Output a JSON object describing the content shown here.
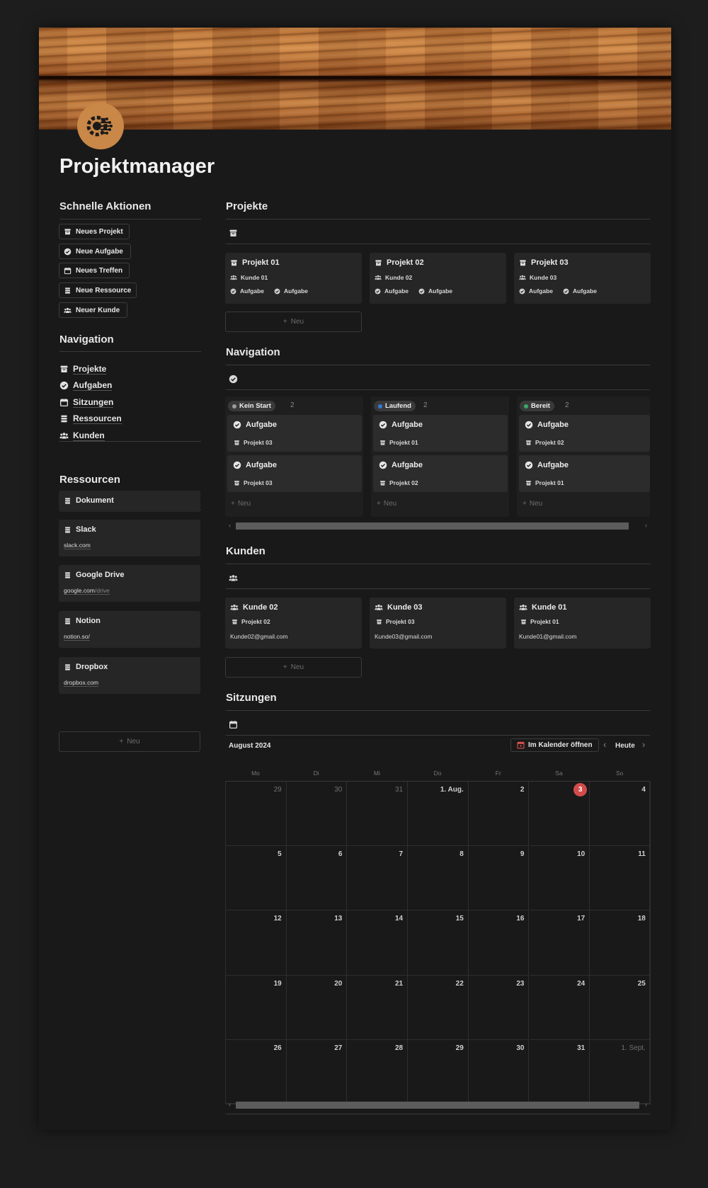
{
  "page_title": "Projektmanager",
  "quick": {
    "heading": "Schnelle Aktionen",
    "buttons": [
      {
        "label": "Neues Projekt",
        "icon": "archive-icon"
      },
      {
        "label": "Neue Aufgabe",
        "icon": "check-circle-icon"
      },
      {
        "label": "Neues Treffen",
        "icon": "calendar-icon"
      },
      {
        "label": "Neue Ressource",
        "icon": "stack-icon"
      },
      {
        "label": "Neuer Kunde",
        "icon": "people-icon"
      }
    ]
  },
  "nav": {
    "heading": "Navigation",
    "items": [
      {
        "label": "Projekte",
        "icon": "archive-icon"
      },
      {
        "label": "Aufgaben",
        "icon": "check-circle-icon"
      },
      {
        "label": "Sitzungen",
        "icon": "calendar-icon"
      },
      {
        "label": "Ressourcen",
        "icon": "stack-icon"
      },
      {
        "label": "Kunden",
        "icon": "people-icon"
      }
    ]
  },
  "resources": {
    "heading": "Ressourcen",
    "new_label": "Neu",
    "items": [
      {
        "name": "Dokument",
        "url": "",
        "url_muted": ""
      },
      {
        "name": "Slack",
        "url": "slack.com",
        "url_muted": ""
      },
      {
        "name": "Google Drive",
        "url": "google.com",
        "url_muted": "/drive"
      },
      {
        "name": "Notion",
        "url": "notion.so/",
        "url_muted": ""
      },
      {
        "name": "Dropbox",
        "url": "dropbox.com",
        "url_muted": ""
      }
    ]
  },
  "projects": {
    "heading": "Projekte",
    "new_label": "Neu",
    "items": [
      {
        "name": "Projekt 01",
        "client": "Kunde 01",
        "task1": "Aufgabe",
        "task2": "Aufgabe"
      },
      {
        "name": "Projekt 02",
        "client": "Kunde 02",
        "task1": "Aufgabe",
        "task2": "Aufgabe"
      },
      {
        "name": "Projekt 03",
        "client": "Kunde 03",
        "task1": "Aufgabe",
        "task2": "Aufgabe"
      }
    ]
  },
  "board": {
    "heading": "Navigation",
    "new_label": "Neu",
    "columns": [
      {
        "status": "Kein Start",
        "count": "2",
        "color": "#9b9b9b",
        "cards": [
          {
            "title": "Aufgabe",
            "project": "Projekt 03"
          },
          {
            "title": "Aufgabe",
            "project": "Projekt 03"
          }
        ]
      },
      {
        "status": "Laufend",
        "count": "2",
        "color": "#2e7cd6",
        "cards": [
          {
            "title": "Aufgabe",
            "project": "Projekt 01"
          },
          {
            "title": "Aufgabe",
            "project": "Projekt 02"
          }
        ]
      },
      {
        "status": "Bereit",
        "count": "2",
        "color": "#3aa86a",
        "cards": [
          {
            "title": "Aufgabe",
            "project": "Projekt 02"
          },
          {
            "title": "Aufgabe",
            "project": "Projekt 01"
          }
        ]
      }
    ]
  },
  "clients": {
    "heading": "Kunden",
    "new_label": "Neu",
    "items": [
      {
        "name": "Kunde 02",
        "project": "Projekt 02",
        "email": "Kunde02@gmail.com"
      },
      {
        "name": "Kunde 03",
        "project": "Projekt 03",
        "email": "Kunde03@gmail.com"
      },
      {
        "name": "Kunde 01",
        "project": "Projekt 01",
        "email": "Kunde01@gmail.com"
      }
    ]
  },
  "calendar": {
    "heading": "Sitzungen",
    "month": "August 2024",
    "open_label": "Im Kalender öffnen",
    "today_label": "Heute",
    "weekdays": [
      "Mo",
      "Di",
      "Mi",
      "Do",
      "Fr",
      "Sa",
      "So"
    ],
    "weeks": [
      [
        {
          "d": "29",
          "dim": true
        },
        {
          "d": "30",
          "dim": true
        },
        {
          "d": "31",
          "dim": true
        },
        {
          "d": "1. Aug."
        },
        {
          "d": "2"
        },
        {
          "d": "3",
          "today": true
        },
        {
          "d": "4"
        }
      ],
      [
        {
          "d": "5"
        },
        {
          "d": "6"
        },
        {
          "d": "7"
        },
        {
          "d": "8"
        },
        {
          "d": "9"
        },
        {
          "d": "10"
        },
        {
          "d": "11"
        }
      ],
      [
        {
          "d": "12"
        },
        {
          "d": "13"
        },
        {
          "d": "14"
        },
        {
          "d": "15"
        },
        {
          "d": "16"
        },
        {
          "d": "17"
        },
        {
          "d": "18"
        }
      ],
      [
        {
          "d": "19"
        },
        {
          "d": "20"
        },
        {
          "d": "21"
        },
        {
          "d": "22"
        },
        {
          "d": "23"
        },
        {
          "d": "24"
        },
        {
          "d": "25"
        }
      ],
      [
        {
          "d": "26"
        },
        {
          "d": "27"
        },
        {
          "d": "28"
        },
        {
          "d": "29"
        },
        {
          "d": "30"
        },
        {
          "d": "31"
        },
        {
          "d": "1. Sept.",
          "dim": true
        }
      ]
    ]
  }
}
